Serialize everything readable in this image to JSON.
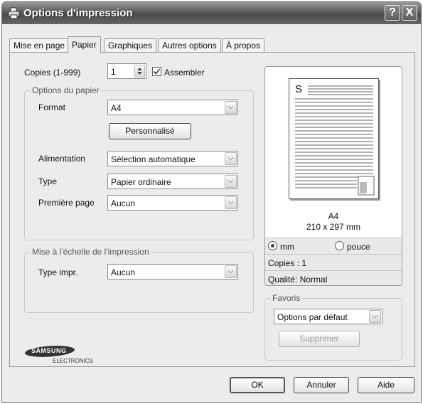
{
  "window": {
    "title": "Options d'impression",
    "help_symbol": "?",
    "close_symbol": "X"
  },
  "tabs": [
    {
      "label": "Mise en page",
      "active": false
    },
    {
      "label": "Papier",
      "active": true
    },
    {
      "label": "Graphiques",
      "active": false
    },
    {
      "label": "Autres options",
      "active": false
    },
    {
      "label": "À propos",
      "active": false
    }
  ],
  "copies": {
    "label": "Copies (1-999)",
    "value": "1",
    "collate_label": "Assembler",
    "collate_checked": true
  },
  "paper_options": {
    "legend": "Options du papier",
    "format_label": "Format",
    "format_value": "A4",
    "custom_button": "Personnalisé",
    "source_label": "Alimentation",
    "source_value": "Sélection automatique",
    "type_label": "Type",
    "type_value": "Papier ordinaire",
    "first_page_label": "Première page",
    "first_page_value": "Aucun"
  },
  "scaling": {
    "legend": "Mise à l'échelle de l'impression",
    "type_label": "Type impr.",
    "type_value": "Aucun"
  },
  "preview": {
    "page_letter": "S",
    "size_name": "A4",
    "size_dims": "210 x 297 mm",
    "unit_mm": "mm",
    "unit_inch": "pouce",
    "unit_selected": "mm",
    "copies_text": "Copies : 1",
    "quality_text": "Qualité: Normal"
  },
  "favorites": {
    "legend": "Favoris",
    "value": "Options par défaut",
    "delete_button": "Supprimer"
  },
  "logo": {
    "brand": "SAMSUNG",
    "sub": "ELECTRONICS"
  },
  "footer": {
    "ok": "OK",
    "cancel": "Annuler",
    "help": "Aide"
  }
}
